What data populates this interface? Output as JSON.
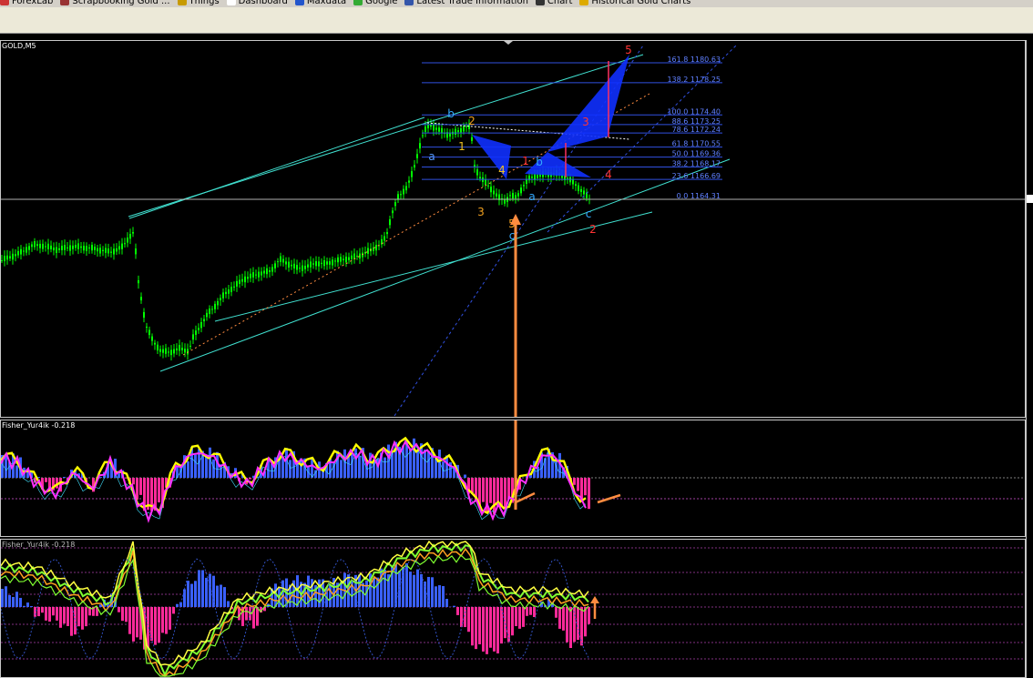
{
  "browser": {
    "bookmarks": [
      {
        "label": "ForexLab",
        "icon": "forex-icon",
        "color": "#cc3333"
      },
      {
        "label": "Scrapbooking Gold ...",
        "icon": "ruby-icon",
        "color": "#993333"
      },
      {
        "label": "Things",
        "icon": "folder-icon",
        "color": "#c79a00"
      },
      {
        "label": "Dashboard",
        "icon": "page-icon",
        "color": "#ffffff"
      },
      {
        "label": "Maxdata",
        "icon": "k-icon",
        "color": "#2255cc"
      },
      {
        "label": "Google",
        "icon": "google-icon",
        "color": "#33aa33"
      },
      {
        "label": "Latest Trade Information",
        "icon": "globe-icon",
        "color": "#3355aa"
      },
      {
        "label": "Chart",
        "icon": "chart-icon",
        "color": "#333333"
      },
      {
        "label": "Historical Gold Charts",
        "icon": "star-icon",
        "color": "#ddaa00"
      }
    ]
  },
  "main_chart": {
    "symbol": "GOLD,M5",
    "fib_levels": [
      {
        "label": "161.8 1180.63"
      },
      {
        "label": "138.2 1178.25"
      },
      {
        "label": "100.0 1174.40"
      },
      {
        "label": "88.6 1173.25"
      },
      {
        "label": "78.6 1172.24"
      },
      {
        "label": "61.8 1170.55"
      },
      {
        "label": "50.0 1169.36"
      },
      {
        "label": "38.2 1168.17"
      },
      {
        "label": "23.6 1166.69"
      },
      {
        "label": "0.0 1164.31"
      }
    ],
    "wave_labels": [
      {
        "text": "5",
        "color": "#ff3333"
      },
      {
        "text": "b",
        "color": "#33aaff"
      },
      {
        "text": "2",
        "color": "#f0a020"
      },
      {
        "text": "1",
        "color": "#f0c020"
      },
      {
        "text": "3",
        "color": "#ff3333"
      },
      {
        "text": "a",
        "color": "#5599ff"
      },
      {
        "text": "4",
        "color": "#f0c020"
      },
      {
        "text": "1",
        "color": "#ff3333"
      },
      {
        "text": "b",
        "color": "#33aaff"
      },
      {
        "text": "4",
        "color": "#ff3333"
      },
      {
        "text": "a",
        "color": "#33aaff"
      },
      {
        "text": "3",
        "color": "#f0a020"
      },
      {
        "text": "5",
        "color": "#f0a020"
      },
      {
        "text": "c",
        "color": "#33aaff"
      },
      {
        "text": "c",
        "color": "#33aaff"
      },
      {
        "text": "2",
        "color": "#ff3333"
      }
    ],
    "colors": {
      "candle_up": "#00ff00",
      "channel": "#40e0d0",
      "fib_line": "#3050e0",
      "fib_text": "#6080ff",
      "harmonic_fill": "#1030ff",
      "arrow": "#ff8c40",
      "trend_dotted": "#ff8c40"
    }
  },
  "indicator_1": {
    "title": "Fisher_Yur4ik -0.218",
    "colors": {
      "pos": "#3a60ff",
      "neg": "#ff2a9a",
      "fast": "#ffff00",
      "slow": "#ff30ff",
      "env": "#40e0ff"
    }
  },
  "indicator_2": {
    "title": "Fisher_Yur4ik -0.218",
    "colors": {
      "pos": "#3a60ff",
      "neg": "#ff2a9a",
      "ma1": "#7fff30",
      "ma2": "#ffa020",
      "ma3": "#ffff40",
      "dots": "#3050c0"
    }
  },
  "chart_data": {
    "type": "candlestick",
    "symbol": "GOLD,M5",
    "title": "GOLD,M5",
    "fibonacci_retracement": [
      {
        "ratio": 161.8,
        "price": 1180.63
      },
      {
        "ratio": 138.2,
        "price": 1178.25
      },
      {
        "ratio": 100.0,
        "price": 1174.4
      },
      {
        "ratio": 88.6,
        "price": 1173.25
      },
      {
        "ratio": 78.6,
        "price": 1172.24
      },
      {
        "ratio": 61.8,
        "price": 1170.55
      },
      {
        "ratio": 50.0,
        "price": 1169.36
      },
      {
        "ratio": 38.2,
        "price": 1168.17
      },
      {
        "ratio": 23.6,
        "price": 1166.69
      },
      {
        "ratio": 0.0,
        "price": 1164.31
      }
    ],
    "indicators": [
      "Fisher_Yur4ik -0.218",
      "Fisher_Yur4ik -0.218"
    ],
    "grid": false
  }
}
